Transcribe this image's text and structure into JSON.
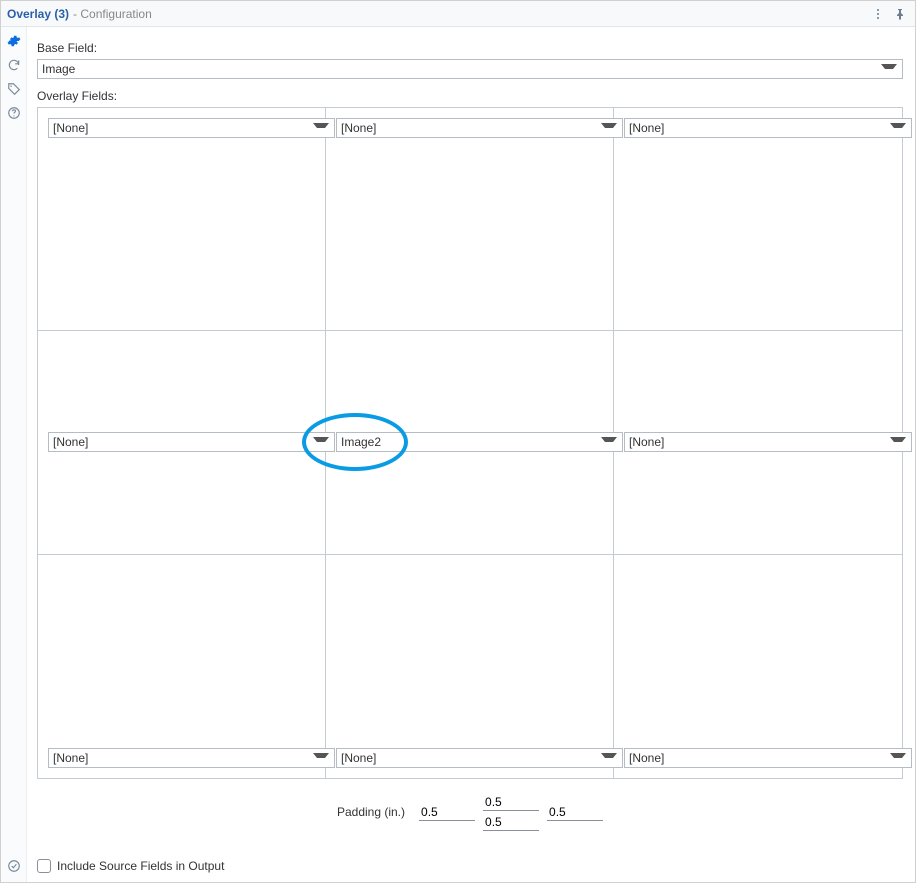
{
  "header": {
    "title": "Overlay (3)",
    "subtitle": "- Configuration"
  },
  "base_field": {
    "label": "Base Field:",
    "value": "Image"
  },
  "overlay_fields": {
    "label": "Overlay Fields:",
    "cells": [
      "[None]",
      "[None]",
      "[None]",
      "[None]",
      "Image2",
      "[None]",
      "[None]",
      "[None]",
      "[None]"
    ]
  },
  "padding": {
    "label": "Padding (in.)",
    "left": "0.5",
    "top": "0.5",
    "bottom": "0.5",
    "right": "0.5"
  },
  "include_source": {
    "label": "Include Source Fields in Output",
    "checked": false
  }
}
